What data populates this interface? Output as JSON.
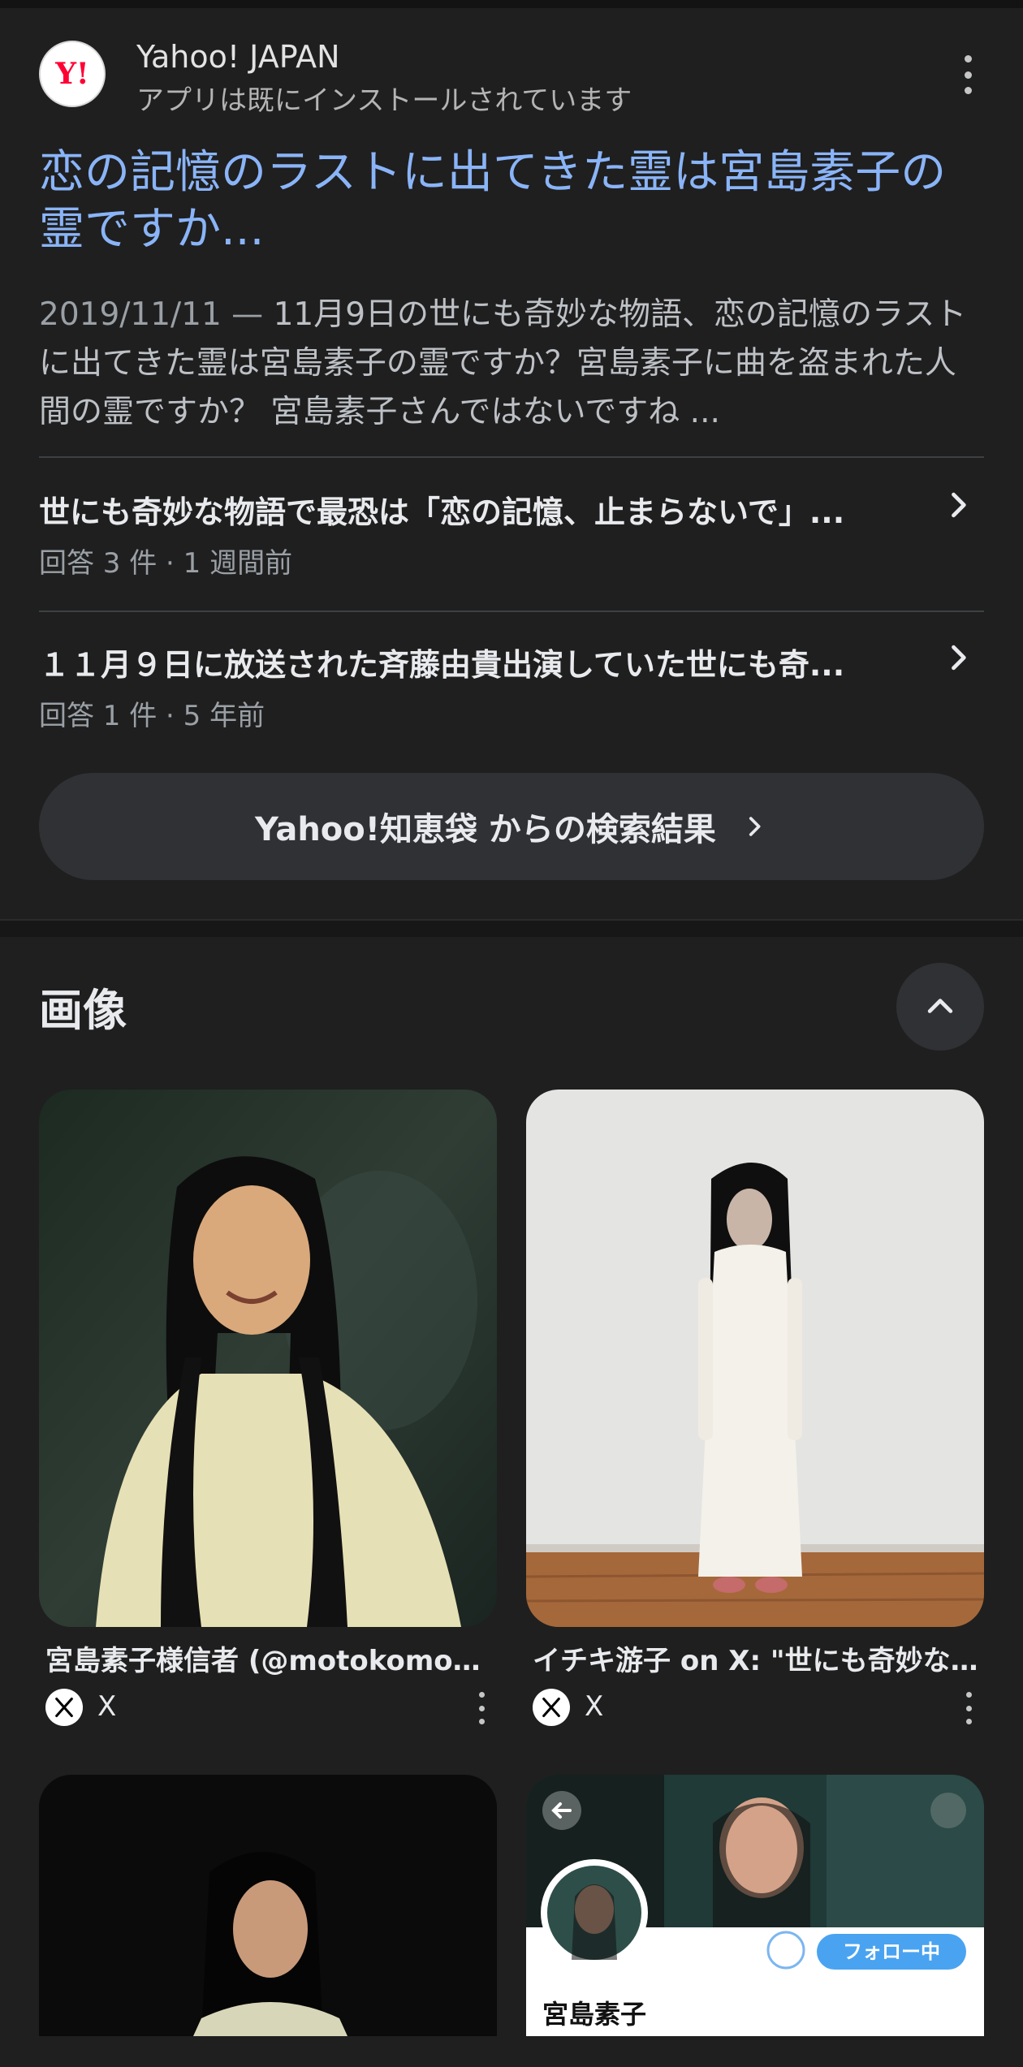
{
  "result": {
    "site_name": "Yahoo! JAPAN",
    "site_sub": "アプリは既にインストールされています",
    "favicon_text": "Y!",
    "title": "恋の記憶のラストに出てきた霊は宮島素子の霊ですか...",
    "snippet_date": "2019/11/11 — ",
    "snippet_text": "11月9日の世にも奇妙な物語、恋の記憶のラストに出てきた霊は宮島素子の霊ですか？宮島素子に曲を盗まれた人間の霊ですか？ 宮島素子さんではないですね ...",
    "qa": [
      {
        "title": "世にも奇妙な物語で最恐は「恋の記憶、止まらないで」...",
        "meta": "回答 3 件 · 1 週間前"
      },
      {
        "title": "１１月９日に放送された斉藤由貴出演していた世にも奇...",
        "meta": "回答 1 件 · 5 年前"
      }
    ],
    "more_button": "Yahoo!知恵袋 からの検索結果"
  },
  "images": {
    "heading": "画像",
    "items": [
      {
        "caption": "宮島素子様信者 (@motokomoto...",
        "source": "X"
      },
      {
        "caption": "イチキ游子 on X: \"世にも奇妙な...",
        "source": "X"
      }
    ],
    "partial_profile_name": "宮島素子",
    "partial_follow_label": "フォロー中"
  },
  "icons": {
    "more": "more-vert-icon",
    "chevron": "chevron-right-icon",
    "collapse": "chevron-up-icon",
    "x_logo": "x-logo-icon"
  },
  "colors": {
    "background": "#1f1f1f",
    "link": "#8ab4f8",
    "surface": "#303134"
  }
}
